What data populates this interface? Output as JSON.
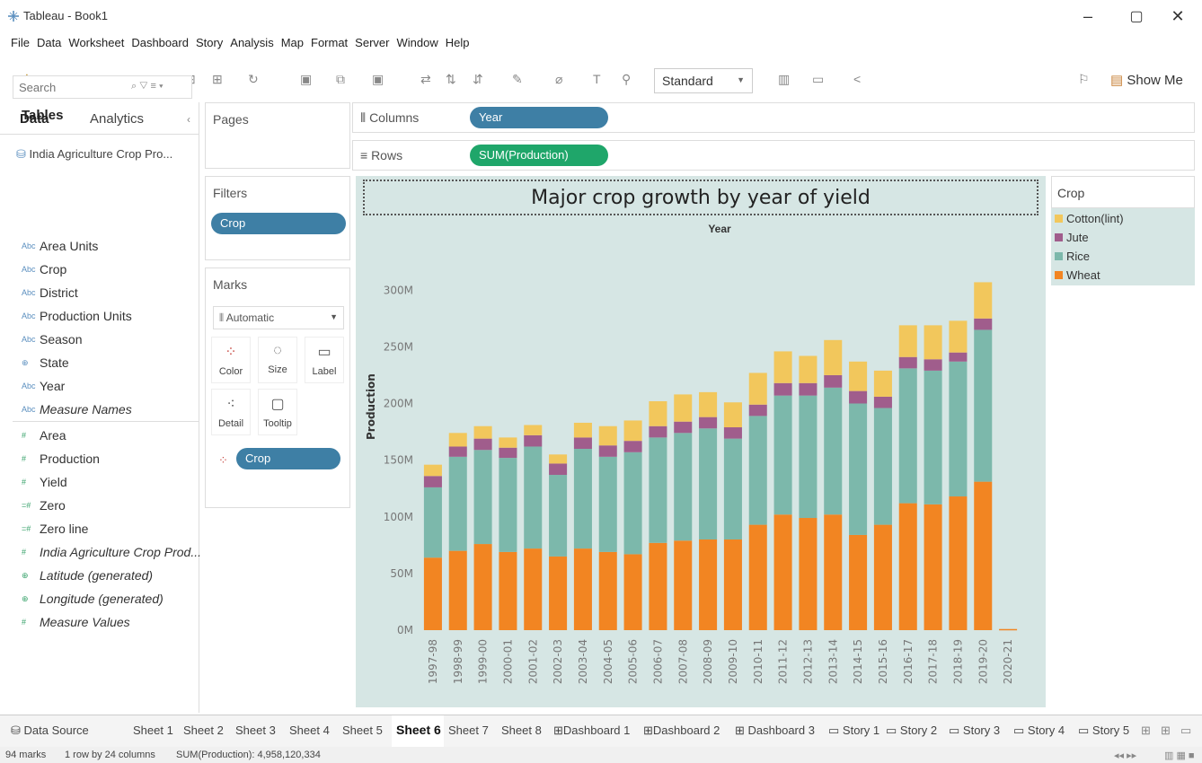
{
  "window": {
    "title": "Tableau - Book1",
    "minimize": "–",
    "restore": "▢",
    "close": "✕"
  },
  "menu": [
    "File",
    "Data",
    "Worksheet",
    "Dashboard",
    "Story",
    "Analysis",
    "Map",
    "Format",
    "Server",
    "Window",
    "Help"
  ],
  "toolbar": {
    "fit_select": "Standard",
    "show_me": "Show Me"
  },
  "data_pane": {
    "tab_data": "Data",
    "tab_analytics": "Analytics",
    "datasource": "India Agriculture Crop Pro...",
    "search_placeholder": "Search",
    "tables_heading": "Tables",
    "dimensions": [
      {
        "type": "Abc",
        "name": "Area Units"
      },
      {
        "type": "Abc",
        "name": "Crop"
      },
      {
        "type": "Abc",
        "name": "District"
      },
      {
        "type": "Abc",
        "name": "Production Units"
      },
      {
        "type": "Abc",
        "name": "Season"
      },
      {
        "type": "⊕",
        "name": "State"
      },
      {
        "type": "Abc",
        "name": "Year"
      },
      {
        "type": "Abc",
        "name": "Measure Names"
      }
    ],
    "measures": [
      {
        "type": "#",
        "name": "Area"
      },
      {
        "type": "#",
        "name": "Production"
      },
      {
        "type": "#",
        "name": "Yield"
      },
      {
        "type": "=#",
        "name": "Zero"
      },
      {
        "type": "=#",
        "name": "Zero line"
      },
      {
        "type": "#",
        "name": "India Agriculture Crop Prod..."
      },
      {
        "type": "⊕",
        "name": "Latitude (generated)"
      },
      {
        "type": "⊕",
        "name": "Longitude (generated)"
      },
      {
        "type": "#",
        "name": "Measure Values"
      }
    ]
  },
  "shelves": {
    "pages": "Pages",
    "filters": "Filters",
    "filter_pill": "Crop",
    "marks": "Marks",
    "mark_type": "Automatic",
    "mark_buttons": [
      "Color",
      "Size",
      "Label",
      "Detail",
      "Tooltip"
    ],
    "marks_pill": "Crop",
    "columns_label": "Columns",
    "columns_pill": "Year",
    "rows_label": "Rows",
    "rows_pill": "SUM(Production)"
  },
  "legend": {
    "title": "Crop",
    "items": [
      {
        "name": "Cotton(lint)",
        "color": "#f2c75c"
      },
      {
        "name": "Jute",
        "color": "#a05d8c"
      },
      {
        "name": "Rice",
        "color": "#7cb8ab"
      },
      {
        "name": "Wheat",
        "color": "#f28522"
      }
    ]
  },
  "chart_data": {
    "type": "bar",
    "stacked": true,
    "title": "Major crop growth by year of yield",
    "xlabel": "Year",
    "ylabel": "Production",
    "ylim": [
      0,
      320000000
    ],
    "yticks": [
      0,
      50000000,
      100000000,
      150000000,
      200000000,
      250000000,
      300000000
    ],
    "ytick_labels": [
      "0M",
      "50M",
      "100M",
      "150M",
      "200M",
      "250M",
      "300M"
    ],
    "categories": [
      "1997-98",
      "1998-99",
      "1999-00",
      "2000-01",
      "2001-02",
      "2002-03",
      "2003-04",
      "2004-05",
      "2005-06",
      "2006-07",
      "2007-08",
      "2008-09",
      "2009-10",
      "2010-11",
      "2011-12",
      "2012-13",
      "2013-14",
      "2014-15",
      "2015-16",
      "2016-17",
      "2017-18",
      "2018-19",
      "2019-20",
      "2020-21"
    ],
    "series": [
      {
        "name": "Wheat",
        "color": "#f28522",
        "values": [
          64,
          70,
          76,
          69,
          72,
          65,
          72,
          69,
          67,
          77,
          79,
          80,
          80,
          93,
          102,
          99,
          102,
          84,
          93,
          112,
          111,
          118,
          131,
          1
        ]
      },
      {
        "name": "Rice",
        "color": "#7cb8ab",
        "values": [
          62,
          83,
          83,
          83,
          90,
          72,
          88,
          84,
          90,
          93,
          95,
          98,
          89,
          96,
          105,
          108,
          112,
          116,
          103,
          119,
          118,
          119,
          134,
          0
        ]
      },
      {
        "name": "Jute",
        "color": "#a05d8c",
        "values": [
          10,
          9,
          10,
          9,
          10,
          10,
          10,
          10,
          10,
          10,
          10,
          10,
          10,
          10,
          11,
          11,
          11,
          11,
          10,
          10,
          10,
          8,
          10,
          0
        ]
      },
      {
        "name": "Cotton(lint)",
        "color": "#f2c75c",
        "values": [
          10,
          12,
          11,
          9,
          9,
          8,
          13,
          17,
          18,
          22,
          24,
          22,
          22,
          28,
          28,
          24,
          31,
          26,
          23,
          28,
          30,
          28,
          32,
          0
        ]
      }
    ],
    "units": "millions",
    "grid": false,
    "legend": "right"
  },
  "sheets": [
    "Data Source",
    "Sheet 1",
    "Sheet 2",
    "Sheet 3",
    "Sheet 4",
    "Sheet 5",
    "Sheet 6",
    "Sheet 7",
    "Sheet 8",
    "Dashboard 1",
    "Dashboard 2",
    "Dashboard 3",
    "Story 1",
    "Story 2",
    "Story 3",
    "Story 4",
    "Story 5"
  ],
  "active_sheet": "Sheet 6",
  "status": {
    "marks": "94 marks",
    "rows_cols": "1 row by 24 columns",
    "sum": "SUM(Production): 4,958,120,334"
  }
}
